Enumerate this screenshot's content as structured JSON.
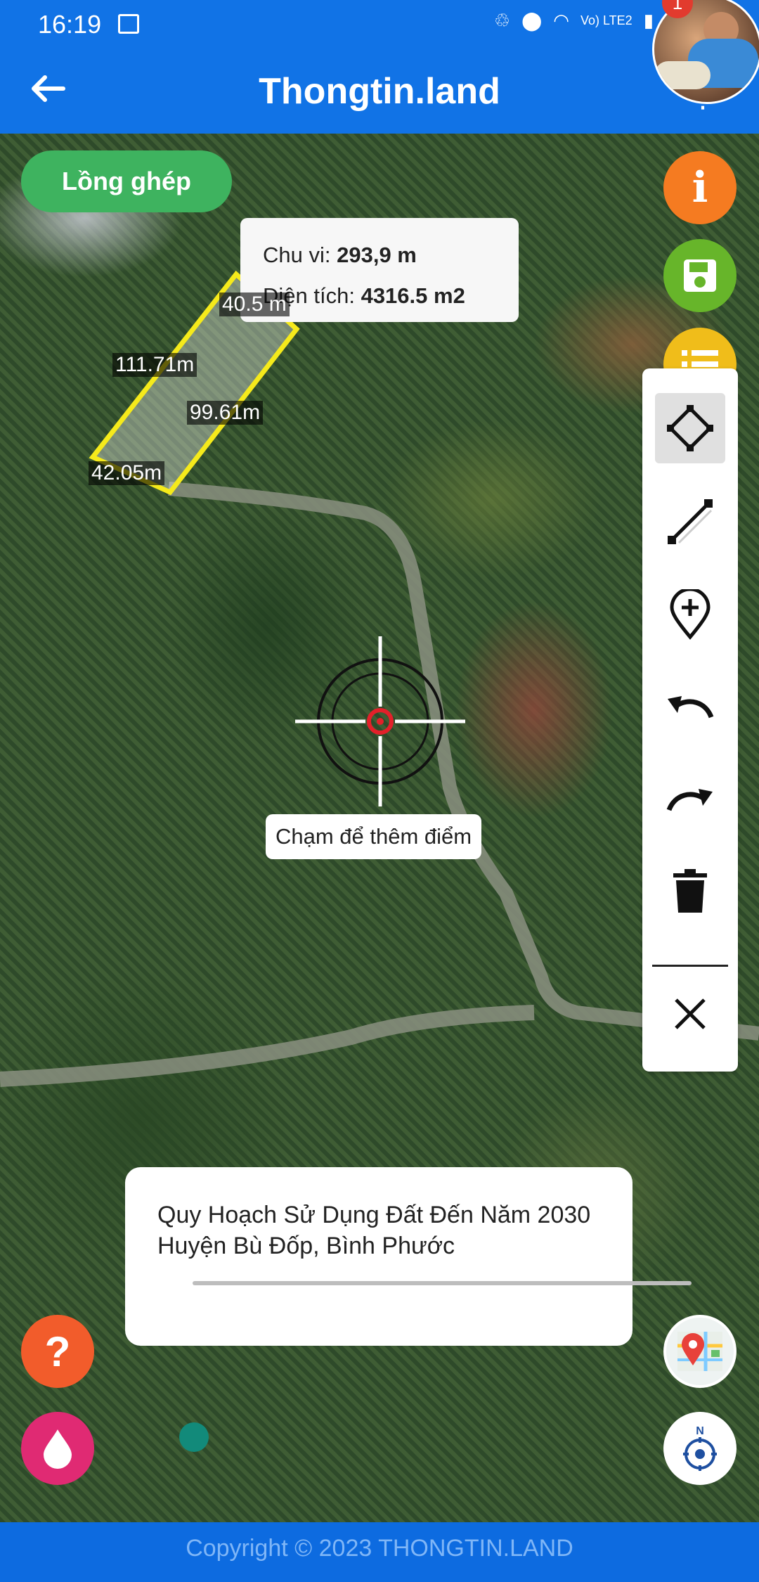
{
  "status_bar": {
    "time": "16:19",
    "network": "Vo) LTE2",
    "notification_count": "1"
  },
  "header": {
    "title": "Thongtin.land"
  },
  "map": {
    "overlay_toggle_label": "Lồng ghép",
    "measurement": {
      "perimeter_label": "Chu vi:",
      "perimeter_value": "293,9 m",
      "area_label": "Diện tích:",
      "area_value": "4316.5 m2"
    },
    "edge_labels": [
      "40.5 m",
      "111.71m",
      "99.61m",
      "42.05m"
    ],
    "tap_hint": "Chạm để thêm điểm",
    "plot_outline_color": "#f5ea1b",
    "crosshair_center_color": "#e3202a"
  },
  "side_buttons": {
    "info_icon": "info-icon",
    "save_icon": "floppy-disk-icon",
    "list_icon": "list-icon",
    "colors": {
      "info": "#f57b21",
      "save": "#67b52a",
      "list": "#f0bd1a"
    }
  },
  "drawing_tools": [
    {
      "name": "polygon-tool",
      "icon": "polygon-draw-icon",
      "active": true
    },
    {
      "name": "line-tool",
      "icon": "line-draw-icon",
      "active": false
    },
    {
      "name": "add-point-tool",
      "icon": "add-location-icon",
      "active": false
    },
    {
      "name": "undo-tool",
      "icon": "undo-icon",
      "active": false
    },
    {
      "name": "redo-tool",
      "icon": "redo-icon",
      "active": false
    },
    {
      "name": "delete-tool",
      "icon": "trash-icon",
      "active": false
    },
    {
      "name": "close-tool",
      "icon": "close-icon",
      "active": false
    }
  ],
  "layer_panel": {
    "title": "Quy Hoạch Sử Dụng Đất Đến Năm 2030 Huyện Bù Đốp, Bình Phước",
    "opacity": 0.0,
    "accent_color": "#128a7a"
  },
  "bottom_buttons": {
    "help_icon": "help-icon",
    "drop_icon": "water-drop-icon",
    "map_layer_icon": "map-layers-icon",
    "compass_icon": "compass-icon",
    "compass_label": "N"
  },
  "footer": {
    "copyright": "Copyright © 2023 THONGTIN.LAND"
  }
}
